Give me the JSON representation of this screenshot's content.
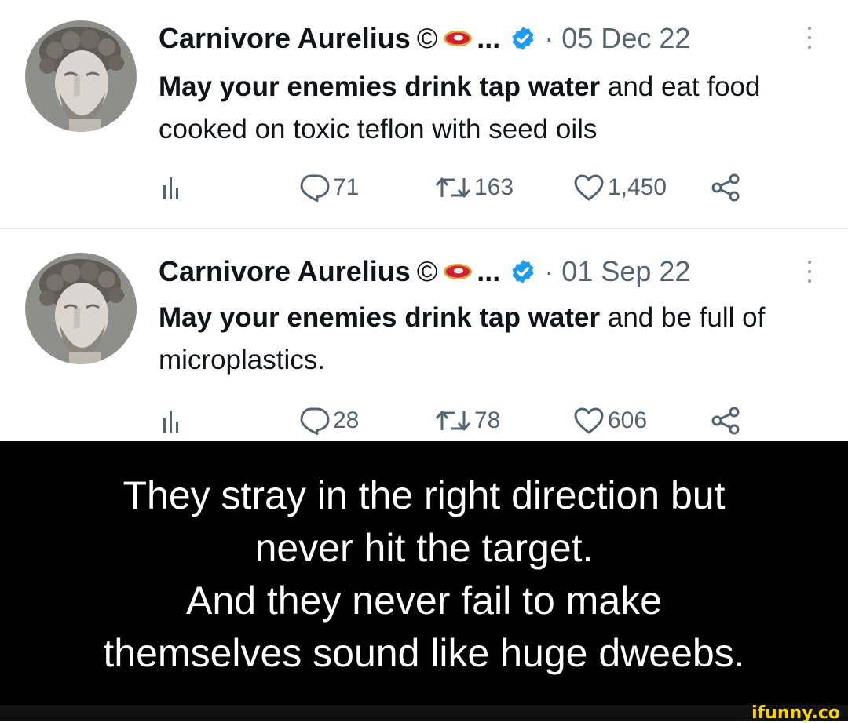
{
  "tweets": [
    {
      "display_name": "Carnivore Aurelius",
      "copyright_mark": "©",
      "ellipsis": "...",
      "date": "· 05 Dec 22",
      "text_bold": "May your enemies drink tap water",
      "text_rest": " and eat food cooked on toxic teflon with seed oils",
      "replies": "71",
      "retweets": "163",
      "likes": "1,450"
    },
    {
      "display_name": "Carnivore Aurelius",
      "copyright_mark": "©",
      "ellipsis": "...",
      "date": "· 01 Sep 22",
      "text_bold": "May your enemies drink tap water",
      "text_rest": " and be full of microplastics.",
      "replies": "28",
      "retweets": "78",
      "likes": "606"
    }
  ],
  "caption": {
    "line1": "They stray in the right direction but",
    "line2": "never hit the target.",
    "line3": "And they never fail to make",
    "line4": "themselves sound like huge dweebs."
  },
  "watermark": "ifunny.co",
  "icons": [
    "bust-avatar",
    "steak-emoji",
    "verified-badge-icon",
    "more-options-icon",
    "analytics-icon",
    "reply-icon",
    "retweet-icon",
    "like-icon",
    "share-icon"
  ],
  "colors": {
    "verified_blue": "#1d9bf0",
    "muted_text": "#536471",
    "caption_bg": "#000000",
    "watermark_yellow": "#f5d400"
  }
}
